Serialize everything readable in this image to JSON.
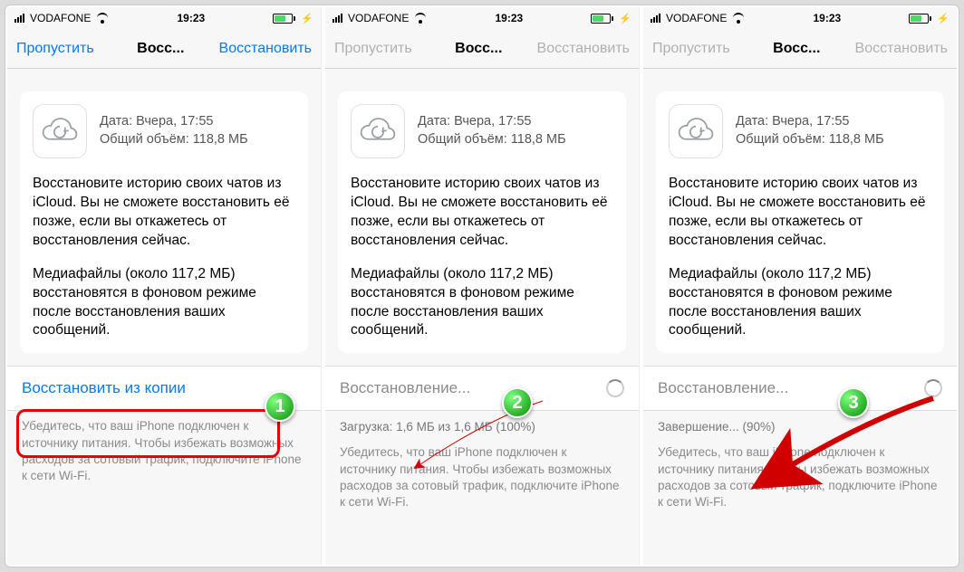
{
  "status": {
    "carrier": "VODAFONE",
    "time": "19:23"
  },
  "nav": {
    "skip": "Пропустить",
    "title": "Восс...",
    "restore": "Восстановить"
  },
  "card": {
    "date_label": "Дата: Вчера, 17:55",
    "size_label": "Общий объём: 118,8 МБ",
    "para1": "Восстановите историю своих чатов из iCloud. Вы не сможете восстановить её позже, если вы откажетесь от восстановления сейчас.",
    "para2": "Медиафайлы (около 117,2 МБ) восстановятся в фоновом режиме после восстановления ваших сообщений."
  },
  "screen1": {
    "action": "Восстановить из копии"
  },
  "screen2": {
    "action": "Восстановление...",
    "progress": "Загрузка: 1,6 МБ из 1,6 МБ (100%)"
  },
  "screen3": {
    "action": "Восстановление...",
    "progress": "Завершение... (90%)"
  },
  "footer": "Убедитесь, что ваш iPhone подключен к источнику питания. Чтобы избежать возможных расходов за сотовый трафик, подключите iPhone к сети Wi-Fi.",
  "badges": {
    "b1": "1",
    "b2": "2",
    "b3": "3"
  }
}
